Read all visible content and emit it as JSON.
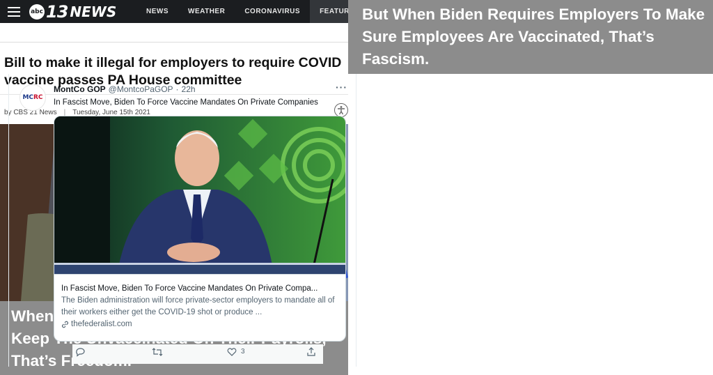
{
  "news_site": {
    "logo_prefix": "abc",
    "logo_number": "13",
    "logo_name": "NEWS",
    "nav": [
      "NEWS",
      "WEATHER",
      "CORONAVIRUS",
      "FEATURES"
    ],
    "headline": "Bill to make it illegal for employers to require COVID vaccine passes PA House committee",
    "byline_source": "by CBS 21 News",
    "byline_sep": "|",
    "byline_date": "Tuesday, June 15th 2021"
  },
  "captions": {
    "left": "When Republicans Require Employers To Keep The Unvaccinated On Their Payrolls, That’s Freedom.",
    "right": "But When Biden Requires Employers To Make Sure Employees Are Vaccinated, That’s Fascism."
  },
  "tweet": {
    "avatar_text_a": "MC",
    "avatar_text_b": "RC",
    "name": "MontCo GOP",
    "handle": "@MontcoPaGOP",
    "dot": "·",
    "time": "22h",
    "more": "···",
    "text": "In Fascist Move, Biden To Force Vaccine Mandates On Private Companies",
    "card_title": "In Fascist Move, Biden To Force Vaccine Mandates On Private Compa...",
    "card_desc": "The Biden administration will force private-sector employers to mandate all of their workers either get the COVID-19 shot or produce ...",
    "card_domain": "thefederalist.com",
    "like_count": "3"
  },
  "colors": {
    "caption_bg": "#8c8c8c",
    "nav_bg": "#1b1d20",
    "glove_blue": "#2f55d4",
    "suit_navy": "#27366b"
  }
}
